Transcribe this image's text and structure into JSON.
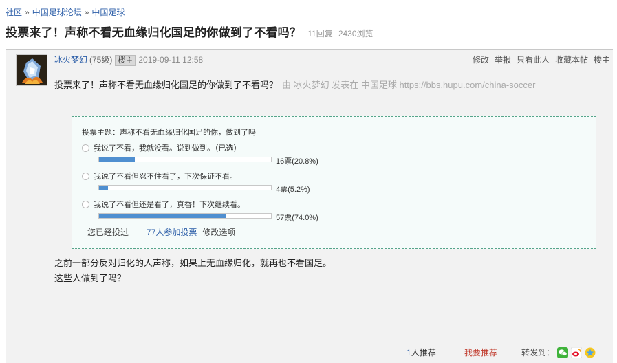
{
  "breadcrumb": {
    "items": [
      "社区",
      "中国足球论坛",
      "中国足球"
    ],
    "separator": "»"
  },
  "thread": {
    "title": "投票来了！声称不看无血缘归化国足的你做到了不看吗？",
    "replies": "11回复",
    "views": "2430浏览"
  },
  "post": {
    "author": "冰火梦幻",
    "level": "(75级)",
    "owner_badge": "楼主",
    "time": "2019-09-11 12:58",
    "actions": [
      "修改",
      "举报",
      "只看此人",
      "收藏本帖",
      "楼主"
    ],
    "headline": "投票来了！声称不看无血缘归化国足的你做到了不看吗？",
    "source_note": "由 冰火梦幻 发表在 中国足球 https://bbs.hupu.com/china-soccer",
    "paragraphs": [
      "之前一部分反对归化的人声称，如果上无血缘归化，就再也不看国足。",
      "这些人做到了吗？"
    ]
  },
  "vote": {
    "subject": "投票主题：声称不看无血缘归化国足的你，做到了吗",
    "options": [
      {
        "label": "我说了不看，我就没看。说到做到。（已选）",
        "count": "16票(20.8%)",
        "percent": 20.8
      },
      {
        "label": "我说了不看但忍不住看了，下次保证不看。",
        "count": "4票(5.2%)",
        "percent": 5.2
      },
      {
        "label": "我说了不看但还是看了，真香！下次继续看。",
        "count": "57票(74.0%)",
        "percent": 74.0
      }
    ],
    "voted_text": "您已经投过",
    "participants": "77人参加投票",
    "modify": "修改选项"
  },
  "footer": {
    "recommend_num": "1",
    "recommend_suffix": "人推荐",
    "recommend_button": "我要推荐",
    "share_label": "转发到：",
    "share_icons": [
      "wechat-icon",
      "weibo-icon",
      "qzone-icon"
    ]
  },
  "colors": {
    "link": "#2c5ea8",
    "vote_fill": "#4f8fd0",
    "vote_border": "#55a58a",
    "recommend": "#c0392b"
  }
}
